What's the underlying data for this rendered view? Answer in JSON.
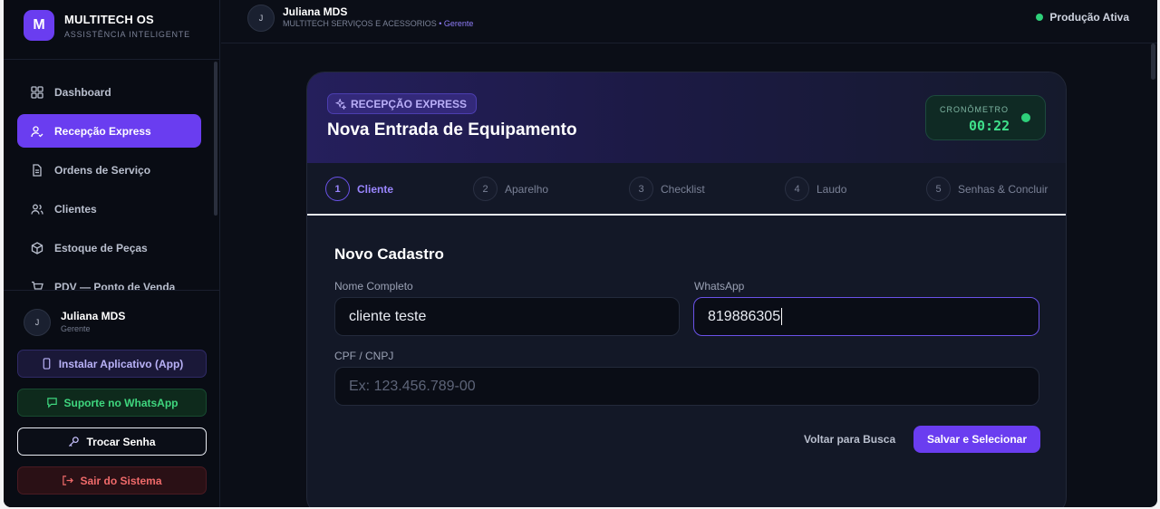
{
  "brand": {
    "logo_letter": "M",
    "title": "MULTITECH OS",
    "subtitle": "ASSISTÊNCIA INTELIGENTE"
  },
  "sidebar": {
    "items": [
      {
        "label": "Dashboard",
        "icon": "dashboard-icon"
      },
      {
        "label": "Recepção Express",
        "icon": "user-check-icon",
        "active": true
      },
      {
        "label": "Ordens de Serviço",
        "icon": "document-icon"
      },
      {
        "label": "Clientes",
        "icon": "users-icon"
      },
      {
        "label": "Estoque de Peças",
        "icon": "box-icon"
      },
      {
        "label": "PDV — Ponto de Venda",
        "icon": "cart-icon"
      }
    ],
    "user": {
      "initial": "J",
      "name": "Juliana MDS",
      "role": "Gerente"
    },
    "buttons": {
      "install": "Instalar Aplicativo (App)",
      "whatsapp": "Suporte no WhatsApp",
      "password": "Trocar Senha",
      "logout": "Sair do Sistema"
    }
  },
  "topbar": {
    "initial": "J",
    "name": "Juliana MDS",
    "company": "MULTITECH SERVIÇOS E ACESSORIOS",
    "role": "• Gerente",
    "status": "Produção Ativa"
  },
  "card": {
    "badge": "RECEPÇÃO EXPRESS",
    "title": "Nova Entrada de Equipamento",
    "timer": {
      "label": "CRONÔMETRO",
      "value": "00:22"
    },
    "steps": [
      {
        "num": "1",
        "label": "Cliente",
        "active": true
      },
      {
        "num": "2",
        "label": "Aparelho"
      },
      {
        "num": "3",
        "label": "Checklist"
      },
      {
        "num": "4",
        "label": "Laudo"
      },
      {
        "num": "5",
        "label": "Senhas & Concluir"
      }
    ],
    "form": {
      "title": "Novo Cadastro",
      "name_label": "Nome Completo",
      "name_value": "cliente teste",
      "whatsapp_label": "WhatsApp",
      "whatsapp_value": "819886305",
      "cpf_label": "CPF / CNPJ",
      "cpf_placeholder": "Ex: 123.456.789-00",
      "back_label": "Voltar para Busca",
      "save_label": "Salvar e Selecionar"
    }
  },
  "colors": {
    "accent": "#6a3df0",
    "success": "#2ed07a",
    "danger": "#f06a6a"
  }
}
